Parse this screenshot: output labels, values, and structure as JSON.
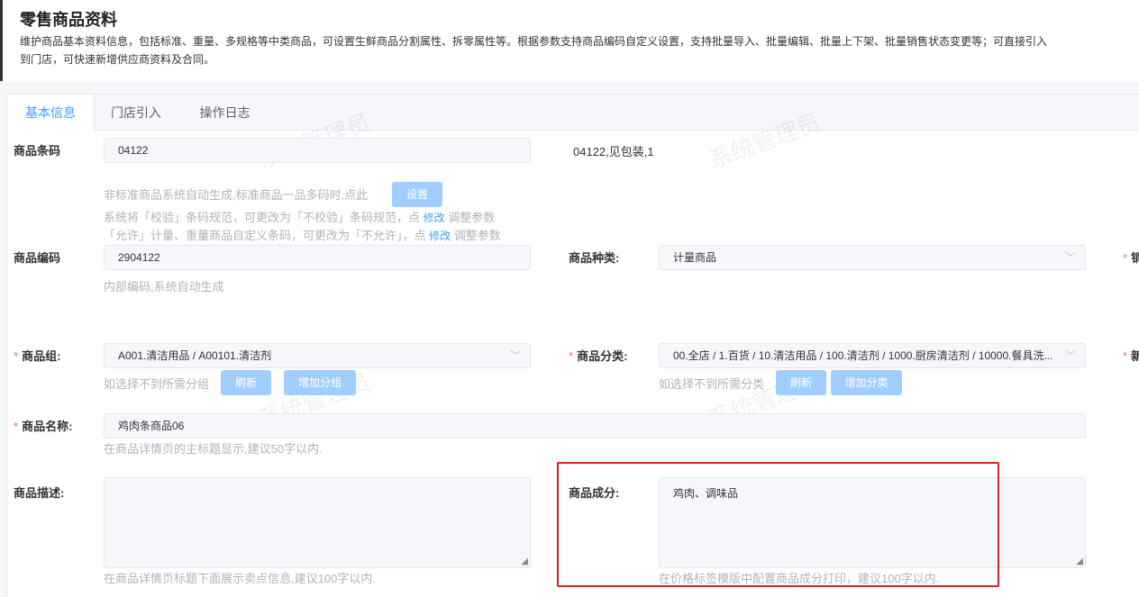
{
  "header": {
    "title": "零售商品资料",
    "description": "维护商品基本资料信息，包括标准、重量、多规格等中类商品，可设置生鲜商品分割属性、拆零属性等。根据参数支持商品编码自定义设置，支持批量导入、批量编辑、批量上下架、批量销售状态变更等；可直接引入到门店，可快速新增供应商资料及合同。"
  },
  "tabs": [
    {
      "label": "基本信息"
    },
    {
      "label": "门店引入"
    },
    {
      "label": "操作日志"
    }
  ],
  "watermark": "系统管理员",
  "form": {
    "barcode": {
      "label": "商品条码",
      "value": "04122",
      "display": "04122,见包装,1",
      "hint": "非标准商品系统自动生成,标准商品一品多码时,点此",
      "set_button": "设置",
      "hint2_pre": "系统将「校验」条码规范，可更改为「不校验」条码规范，点",
      "hint3_pre": "「允许」计量、重量商品自定义条码，可更改为「不允许」，点",
      "modify_link": "修改",
      "adjust_text": "调整参数"
    },
    "code": {
      "label": "商品编码",
      "value": "2904122",
      "hint": "内部编码,系统自动生成"
    },
    "kind": {
      "label": "商品种类:",
      "value": "计量商品"
    },
    "sales_label_fragment": "销",
    "group": {
      "label": "商品组:",
      "value": "A001.清洁用品 / A00101.清洁剂",
      "hint": "如选择不到所需分组",
      "refresh": "刷新",
      "add": "增加分组"
    },
    "category": {
      "label": "商品分类:",
      "value": "00.全店 / 1.百货 / 10.清洁用品 / 100.清洁剂 / 1000.厨房清洁剂 / 10000.餐具洗...",
      "hint": "如选择不到所需分类",
      "refresh": "刷新",
      "add": "增加分类"
    },
    "new_label_fragment": "新",
    "name": {
      "label": "商品名称:",
      "value": "鸡肉条商品06",
      "hint": "在商品详情页的主标题显示,建议50字以内."
    },
    "desc": {
      "label": "商品描述:",
      "value": "",
      "hint": "在商品详情页标题下面展示卖点信息,建议100字以内."
    },
    "ingredients": {
      "label": "商品成分:",
      "value": "鸡肉、调味品",
      "hint": "在价格标签模版中配置商品成分打印，建议100字以内."
    }
  },
  "colors": {
    "accent": "#409eff",
    "button": "#a0cfff",
    "required": "#f56c6c",
    "highlight": "#e02020"
  }
}
